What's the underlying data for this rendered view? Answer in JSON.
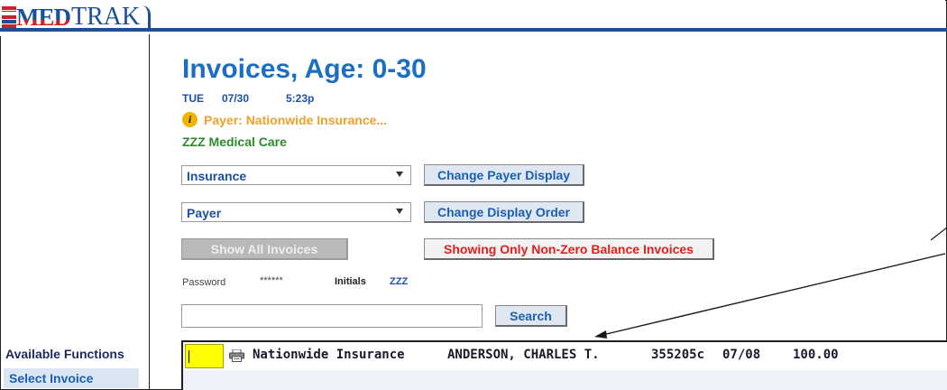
{
  "app": {
    "logo_med": "MED",
    "logo_trak": "TRAK"
  },
  "page": {
    "title": "Invoices, Age: 0-30",
    "day": "TUE",
    "date": "07/30",
    "time": "5:23p",
    "payer_notice": "Payer: Nationwide Insurance...",
    "clinic": "ZZZ Medical Care"
  },
  "controls": {
    "payer_type_select": "Insurance",
    "change_payer_display": "Change Payer Display",
    "order_select": "Payer",
    "change_display_order": "Change Display Order",
    "show_all_invoices": "Show All Invoices",
    "showing_only_nonzero": "Showing Only Non-Zero Balance Invoices"
  },
  "credentials": {
    "password_label": "Password",
    "password_value": "******",
    "initials_label": "Initials",
    "initials_value": "ZZZ"
  },
  "search": {
    "value": "",
    "button": "Search"
  },
  "sidebar": {
    "title": "Available Functions",
    "items": [
      {
        "label": "Select Invoice"
      }
    ]
  },
  "invoices": [
    {
      "payer": "Nationwide Insurance",
      "patient": "ANDERSON, CHARLES T.",
      "invoice": "355205c",
      "date": "07/08",
      "amount": "100.00"
    }
  ],
  "icons": {
    "info": "info-icon",
    "printer": "printer-icon",
    "dropdown": "chevron-down-icon"
  },
  "colors": {
    "accent": "#1b6ec2",
    "warning": "#f0a028",
    "clinic": "#2e8b2e",
    "danger": "#e0201c",
    "highlight": "#ffff00"
  }
}
